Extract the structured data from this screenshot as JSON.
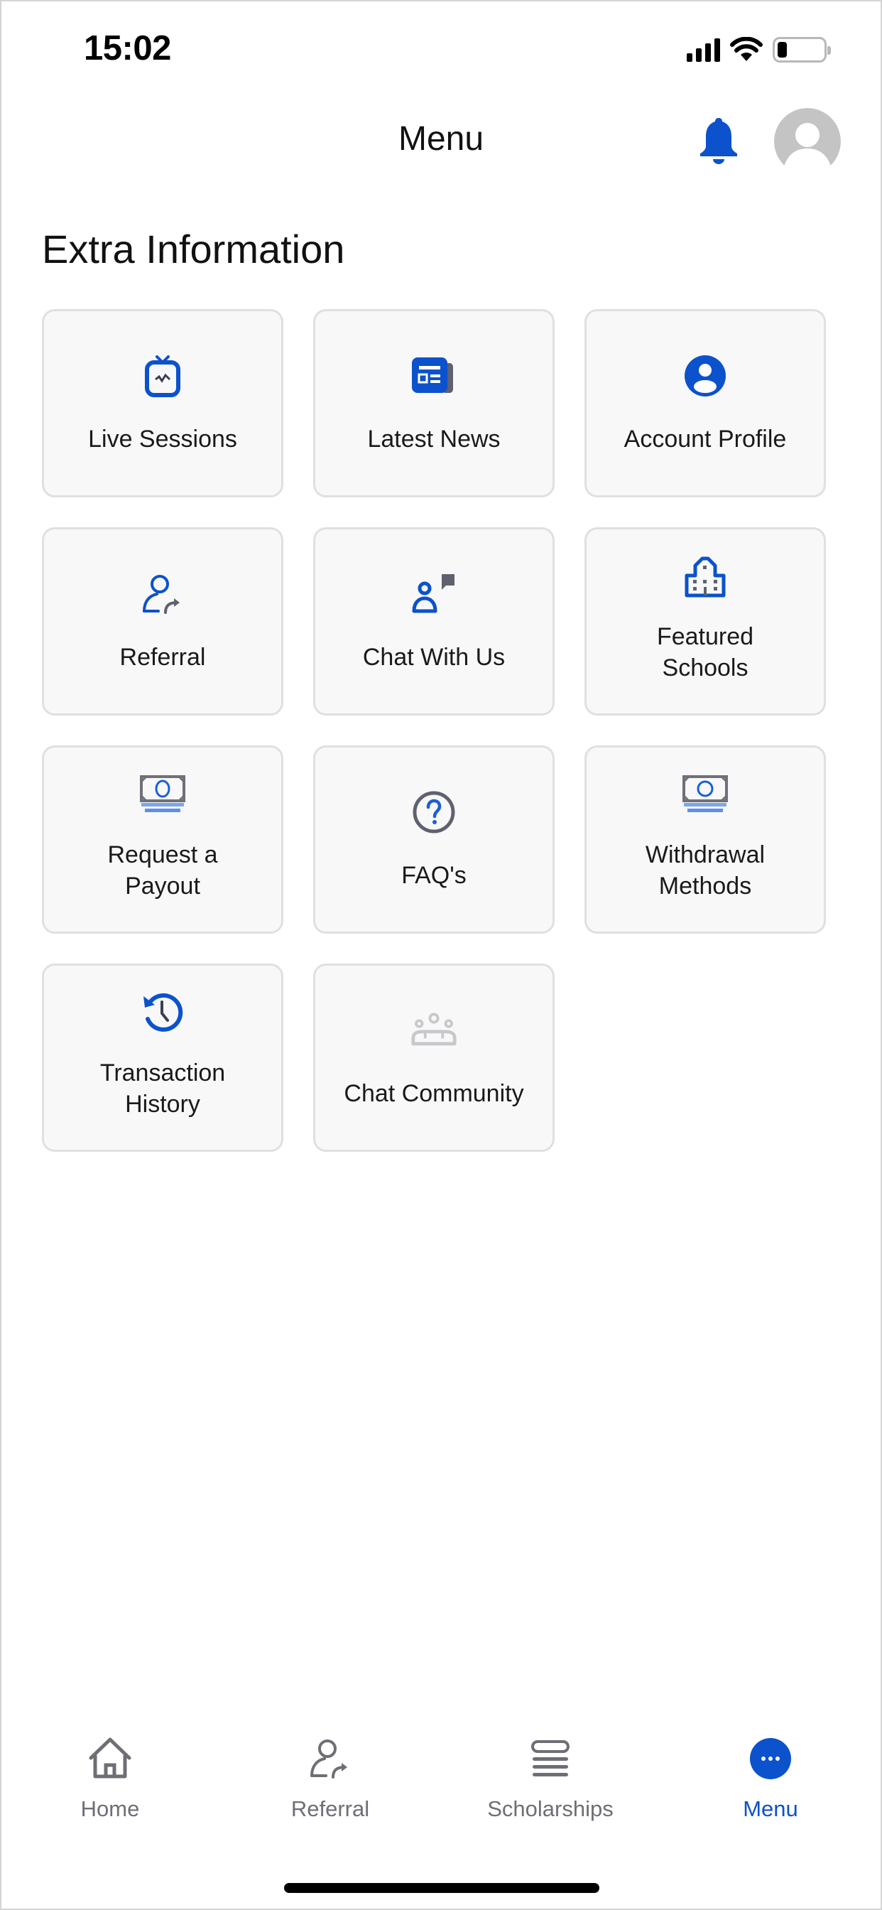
{
  "status_bar": {
    "time": "15:02",
    "icons": [
      "cellular-signal-icon",
      "wifi-icon",
      "battery-icon"
    ],
    "battery_level_percent": 20
  },
  "header": {
    "title": "Menu",
    "icons": [
      "notification-bell-icon",
      "user-avatar-icon"
    ]
  },
  "section": {
    "title": "Extra Information",
    "tiles": [
      {
        "label": "Live Sessions",
        "icon": "live-tv-icon"
      },
      {
        "label": "Latest News",
        "icon": "newspaper-icon"
      },
      {
        "label": "Account Profile",
        "icon": "account-circle-icon"
      },
      {
        "label": "Referral",
        "icon": "person-share-icon"
      },
      {
        "label": "Chat With Us",
        "icon": "person-chat-icon"
      },
      {
        "label": "Featured Schools",
        "icon": "school-building-icon"
      },
      {
        "label": "Request a Payout",
        "icon": "cash-stack-icon"
      },
      {
        "label": "FAQ's",
        "icon": "question-circle-icon"
      },
      {
        "label": "Withdrawal Methods",
        "icon": "cash-stack-icon"
      },
      {
        "label": "Transaction History",
        "icon": "history-clock-icon"
      },
      {
        "label": "Chat Community",
        "icon": "group-icon"
      }
    ]
  },
  "bottom_nav": {
    "items": [
      {
        "label": "Home",
        "icon": "home-icon",
        "active": false
      },
      {
        "label": "Referral",
        "icon": "person-share-icon",
        "active": false
      },
      {
        "label": "Scholarships",
        "icon": "stack-list-icon",
        "active": false
      },
      {
        "label": "Menu",
        "icon": "more-dots-icon",
        "active": true
      }
    ]
  },
  "colors": {
    "accent": "#0b52cc",
    "icon_gray": "#5f6170",
    "tile_bg": "#f8f8f8",
    "tile_border": "#e0e0e0",
    "inactive_nav": "#6e6e75",
    "avatar_gray": "#c4c4c4"
  }
}
